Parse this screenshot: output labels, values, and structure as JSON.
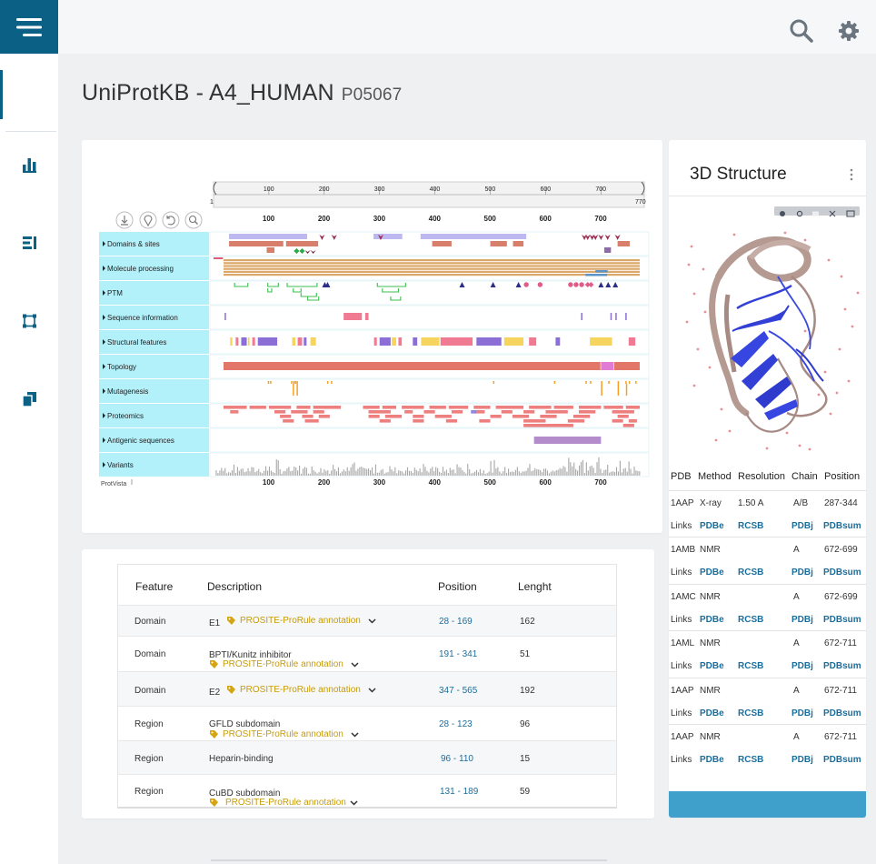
{
  "header": {
    "title": "UniProtKB - A4_HUMAN",
    "accession": "P05067"
  },
  "sidebar": {
    "items": [
      {
        "icon": "bars-chart-icon"
      },
      {
        "icon": "list-icon"
      },
      {
        "icon": "network-icon"
      },
      {
        "icon": "copy-icon"
      }
    ]
  },
  "topbar": {
    "icons": [
      "search-icon",
      "gear-icon"
    ]
  },
  "colors": {
    "brand": "#0a6185",
    "accent": "#3fa0cc",
    "track_label_bg": "#b2f0fa",
    "link": "#1b6e9c",
    "annotation": "#c79b0b"
  },
  "protvista": {
    "ruler_start": "1",
    "ruler_end": "770",
    "ruler_ticks": [
      "100",
      "200",
      "300",
      "400",
      "500",
      "600",
      "700"
    ],
    "tracks": [
      "Domains & sites",
      "Molecule processing",
      "PTM",
      "Sequence information",
      "Structural features",
      "Topology",
      "Mutagenesis",
      "Proteomics",
      "Antigenic sequences",
      "Variants"
    ],
    "footer_label": "ProtVista",
    "tools": [
      "download-icon",
      "location-icon",
      "reset-icon",
      "zoom-icon"
    ]
  },
  "features": {
    "columns": [
      "Feature",
      "Description",
      "Position",
      "Lenght"
    ],
    "rows": [
      {
        "feature": "Domain",
        "description": "E1",
        "annotation": "PROSITE-ProRule annotation",
        "position": "28 - 169",
        "length": "162"
      },
      {
        "feature": "Domain",
        "description": "BPTI/Kunitz inhibitor",
        "annotation": "PROSITE-ProRule annotation",
        "position": "191 - 341",
        "length": "51"
      },
      {
        "feature": "Domain",
        "description": "E2",
        "annotation": "PROSITE-ProRule annotation",
        "position": "347 - 565",
        "length": "192"
      },
      {
        "feature": "Region",
        "description": "GFLD subdomain",
        "annotation": "PROSITE-ProRule annotation",
        "position": "28 - 123",
        "length": "96"
      },
      {
        "feature": "Region",
        "description": "Heparin-binding",
        "annotation": "",
        "position": "96 - 110",
        "length": "15"
      },
      {
        "feature": "Region",
        "description": "CuBD subdomain",
        "annotation": "PROSITE-ProRule annotation",
        "position": "131 - 189",
        "length": "59"
      }
    ]
  },
  "structure": {
    "title": "3D Structure",
    "columns": [
      "PDB",
      "Method",
      "Resolution",
      "Chain",
      "Position"
    ],
    "links_label": "Links",
    "entries": [
      {
        "pdb": "1AAP",
        "method": "X-ray",
        "resolution": "1.50 A",
        "chain": "A/B",
        "position": "287-344",
        "links": [
          "PDBe",
          "RCSB",
          "PDBj",
          "PDBsum"
        ]
      },
      {
        "pdb": "1AMB",
        "method": "NMR",
        "resolution": "",
        "chain": "A",
        "position": "672-699",
        "links": [
          "PDBe",
          "RCSB",
          "PDBj",
          "PDBsum"
        ]
      },
      {
        "pdb": "1AMC",
        "method": "NMR",
        "resolution": "",
        "chain": "A",
        "position": "672-699",
        "links": [
          "PDBe",
          "RCSB",
          "PDBj",
          "PDBsum"
        ]
      },
      {
        "pdb": "1AML",
        "method": "NMR",
        "resolution": "",
        "chain": "A",
        "position": "672-711",
        "links": [
          "PDBe",
          "RCSB",
          "PDBj",
          "PDBsum"
        ]
      },
      {
        "pdb": "1AAP",
        "method": "NMR",
        "resolution": "",
        "chain": "A",
        "position": "672-711",
        "links": [
          "PDBe",
          "RCSB",
          "PDBj",
          "PDBsum"
        ]
      },
      {
        "pdb": "1AAP",
        "method": "NMR",
        "resolution": "",
        "chain": "A",
        "position": "672-711",
        "links": [
          "PDBe",
          "RCSB",
          "PDBj",
          "PDBsum"
        ]
      }
    ]
  }
}
